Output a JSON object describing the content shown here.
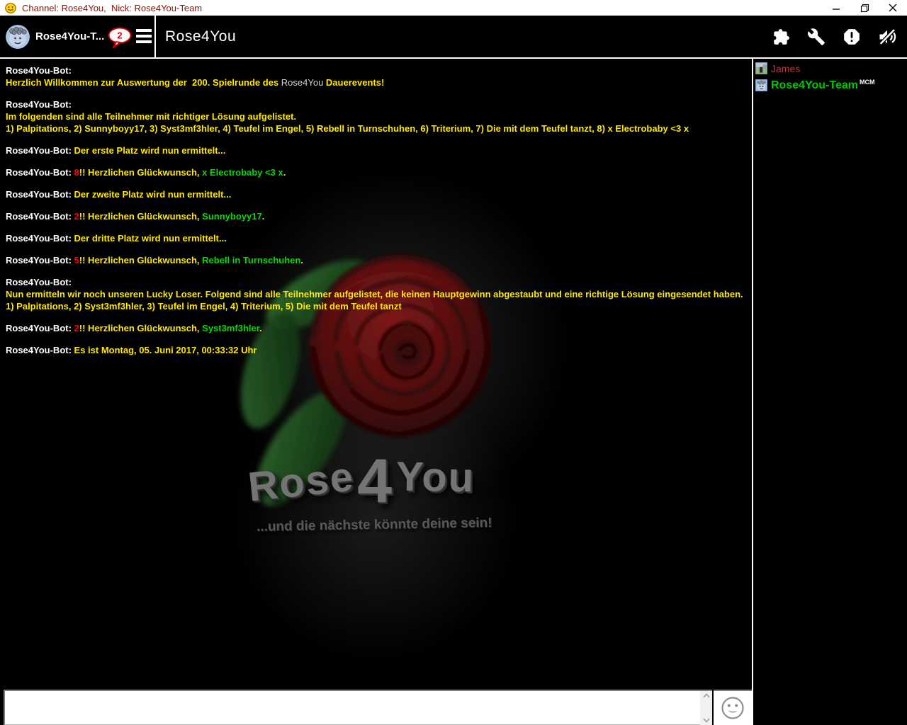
{
  "titlebar": {
    "title": "Channel: Rose4You,  Nick: Rose4You-Team",
    "app_icon": "knuddels-smiley-icon",
    "controls": [
      "minimize",
      "restore",
      "close"
    ]
  },
  "header": {
    "tab": {
      "label": "Rose4You-T...",
      "badge_count": "2",
      "avatar": "rose4you-team-avatar"
    },
    "menu_icon": "hamburger-icon",
    "channel_title": "Rose4You",
    "toolbar_icons": [
      "plugin-icon",
      "wrench-icon",
      "alert-icon",
      "sound-muted-icon"
    ]
  },
  "chat": {
    "messages": [
      [
        {
          "style": "author",
          "text": "Rose4You-Bot:\n"
        },
        {
          "style": "yellow",
          "text": "Herzlich Willkommen zur Auswertung der  200. Spielrunde des "
        },
        {
          "style": "brand",
          "text": "Rose4You"
        },
        {
          "style": "yellow",
          "text": " Dauerevents!"
        }
      ],
      [
        {
          "style": "author",
          "text": "Rose4You-Bot:\n"
        },
        {
          "style": "yellow",
          "text": "Im folgenden sind alle Teilnehmer mit richtiger Lösung aufgelistet.\n1) Palpitations, 2) Sunnyboyy17, 3) Syst3mf3hler, 4) Teufel im Engel, 5) Rebell in Turnschuhen, 6) Triterium, 7) Die mit dem Teufel tanzt, 8) x Electrobaby <3 x"
        }
      ],
      [
        {
          "style": "author",
          "text": "Rose4You-Bot: "
        },
        {
          "style": "yellow",
          "text": "Der erste Platz wird nun ermittelt..."
        }
      ],
      [
        {
          "style": "author",
          "text": "Rose4You-Bot: "
        },
        {
          "style": "red",
          "text": "8"
        },
        {
          "style": "yellow",
          "text": "!! Herzlichen Glückwunsch, "
        },
        {
          "style": "green",
          "text": "x Electrobaby <3 x"
        },
        {
          "style": "yellow",
          "text": "."
        }
      ],
      [
        {
          "style": "author",
          "text": "Rose4You-Bot: "
        },
        {
          "style": "yellow",
          "text": "Der zweite Platz wird nun ermittelt..."
        }
      ],
      [
        {
          "style": "author",
          "text": "Rose4You-Bot: "
        },
        {
          "style": "red",
          "text": "2"
        },
        {
          "style": "yellow",
          "text": "!! Herzlichen Glückwunsch, "
        },
        {
          "style": "green",
          "text": "Sunnyboyy17"
        },
        {
          "style": "yellow",
          "text": "."
        }
      ],
      [
        {
          "style": "author",
          "text": "Rose4You-Bot: "
        },
        {
          "style": "yellow",
          "text": "Der dritte Platz wird nun ermittelt..."
        }
      ],
      [
        {
          "style": "author",
          "text": "Rose4You-Bot: "
        },
        {
          "style": "red",
          "text": "5"
        },
        {
          "style": "yellow",
          "text": "!! Herzlichen Glückwunsch, "
        },
        {
          "style": "green",
          "text": "Rebell in Turnschuhen"
        },
        {
          "style": "yellow",
          "text": "."
        }
      ],
      [
        {
          "style": "author",
          "text": "Rose4You-Bot:\n"
        },
        {
          "style": "yellow",
          "text": "Nun ermitteln wir noch unseren Lucky Loser. Folgend sind alle Teilnehmer aufgelistet, die keinen Hauptgewinn abgestaubt und eine richtige Lösung eingesendet haben.\n1) Palpitations, 2) Syst3mf3hler, 3) Teufel im Engel, 4) Triterium, 5) Die mit dem Teufel tanzt"
        }
      ],
      [
        {
          "style": "author",
          "text": "Rose4You-Bot: "
        },
        {
          "style": "red",
          "text": "2"
        },
        {
          "style": "yellow",
          "text": "!! Herzlichen Glückwunsch, "
        },
        {
          "style": "green",
          "text": "Syst3mf3hler"
        },
        {
          "style": "yellow",
          "text": "."
        }
      ],
      [
        {
          "style": "author",
          "text": "Rose4You-Bot: "
        },
        {
          "style": "yellow",
          "text": "Es ist Montag, 05. Juni 2017, 00:33:32 Uhr"
        }
      ]
    ]
  },
  "watermark": {
    "logo_rose": "Rose",
    "logo_4": "4",
    "logo_you": "You",
    "tagline": "...und die nächste könnte deine sein!"
  },
  "userlist": {
    "users": [
      {
        "name": "James",
        "color": "#cf3232",
        "badge": "",
        "icon": "james-avatar"
      },
      {
        "name": "Rose4You-Team",
        "color": "#00c800",
        "badge": "MCM",
        "icon": "rose4you-team-avatar"
      }
    ]
  },
  "composer": {
    "value": "",
    "smiley_icon": "smiley-icon"
  },
  "colors": {
    "message_yellow": "#ffe800",
    "message_red": "#ff0000",
    "message_green": "#00dd00",
    "author_white": "#ffffff",
    "brand_gray": "#cfcfcf",
    "james_red": "#cf3232",
    "team_green": "#00c800",
    "title_maroon": "#8a1200"
  }
}
